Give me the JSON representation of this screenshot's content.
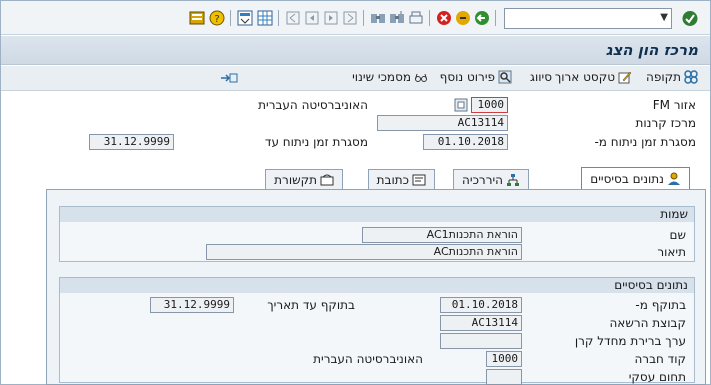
{
  "title": "מרכז הון הצג",
  "command_field": {
    "value": ""
  },
  "app_toolbar": {
    "attributes": "תקופה",
    "long_text": "טקסט ארוך",
    "classification": "סיווג",
    "additional_details": "פירוט נוסף",
    "change_documents": "מסמכי שינוי"
  },
  "header": {
    "fm_area_label": "אזור FM",
    "fm_area_value": "1000",
    "fm_area_desc": "האוניברסיטה העברית",
    "fund_center_label": "מרכז קרנות",
    "fund_center_value": "AC13114",
    "timeframe_label": "מסגרת זמן ניתוח מ-",
    "timeframe_from": "01.10.2018",
    "timeframe_to_label": "מסגרת זמן ניתוח עד",
    "timeframe_to": "31.12.9999"
  },
  "tabs": [
    {
      "label": "נתונים בסיסיים",
      "active": true
    },
    {
      "label": "היררכיה",
      "active": false
    },
    {
      "label": "כתובת",
      "active": false
    },
    {
      "label": "תקשורת",
      "active": false
    }
  ],
  "names_group": {
    "title": "שמות",
    "name_label": "שם",
    "name_value": "הוראת התכנותAC1",
    "description_label": "תיאור",
    "description_value": "הוראת התכנותAC"
  },
  "basic_group": {
    "title": "נתונים בסיסיים",
    "valid_from_label": "בתוקף מ-",
    "valid_from": "01.10.2018",
    "valid_to_label": "בתוקף עד תאריך",
    "valid_to": "31.12.9999",
    "auth_group_label": "קבוצת הרשאה",
    "auth_group": "AC13114",
    "fund_default_label": "ערך ברירת מחדל קרן",
    "fund_default": "",
    "company_code_label": "קוד חברה",
    "company_code": "1000",
    "company_desc": "האוניברסיטה העברית",
    "business_area_label": "תחום עסקי",
    "business_area": ""
  }
}
